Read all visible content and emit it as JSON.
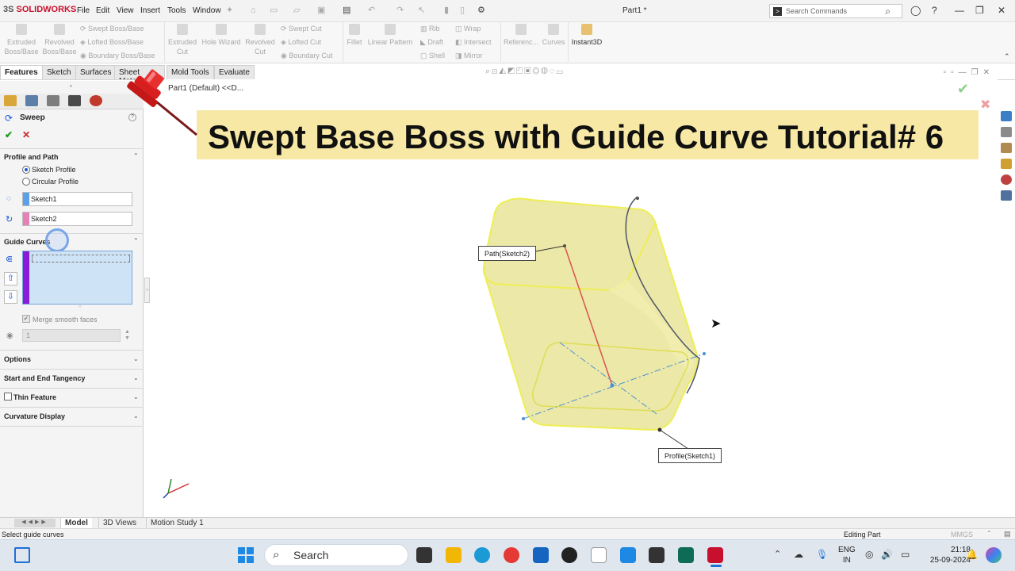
{
  "app": {
    "brand": "SOLIDWORKS",
    "brand_prefix": "3S",
    "document_title": "Part1 *",
    "menu": [
      "File",
      "Edit",
      "View",
      "Insert",
      "Tools",
      "Window"
    ],
    "command_search_placeholder": "Search Commands"
  },
  "ribbon": {
    "large": [
      {
        "label": "Extruded Boss/Base"
      },
      {
        "label": "Revolved Boss/Base"
      },
      {
        "label": "Extruded Cut"
      },
      {
        "label": "Hole Wizard"
      },
      {
        "label": "Revolved Cut"
      },
      {
        "label": "Fillet"
      },
      {
        "label": "Linear Pattern"
      },
      {
        "label": "Referenc..."
      },
      {
        "label": "Curves"
      },
      {
        "label": "Instant3D"
      }
    ],
    "small": [
      {
        "label": "Swept Boss/Base"
      },
      {
        "label": "Lofted Boss/Base"
      },
      {
        "label": "Boundary Boss/Base"
      },
      {
        "label": "Swept Cut"
      },
      {
        "label": "Lofted Cut"
      },
      {
        "label": "Boundary Cut"
      },
      {
        "label": "Rib"
      },
      {
        "label": "Draft"
      },
      {
        "label": "Shell"
      },
      {
        "label": "Wrap"
      },
      {
        "label": "Intersect"
      },
      {
        "label": "Mirror"
      }
    ]
  },
  "tabs": [
    "Features",
    "Sketch",
    "Surfaces",
    "Sheet Metal",
    "Mold Tools",
    "Evaluate"
  ],
  "tree_breadcrumb": "Part1 (Default) <<D...",
  "property_manager": {
    "title": "Sweep",
    "profile_and_path": {
      "heading": "Profile and Path",
      "option_sketch": "Sketch Profile",
      "option_circular": "Circular Profile",
      "profile_value": "Sketch1",
      "path_value": "Sketch2"
    },
    "guide_curves": {
      "heading": "Guide Curves",
      "merge_smooth": "Merge smooth faces",
      "count_value": "1"
    },
    "sections": [
      "Options",
      "Start and End Tangency",
      "Thin Feature",
      "Curvature Display"
    ]
  },
  "viewport": {
    "banner": "Swept Base Boss with Guide Curve Tutorial# 6",
    "callout_path": "Path(Sketch2)",
    "callout_profile": "Profile(Sketch1)"
  },
  "bottom_tabs": [
    "Model",
    "3D Views",
    "Motion Study 1"
  ],
  "status": {
    "left": "Select guide curves",
    "mode": "Editing Part",
    "units": "MMGS"
  },
  "taskbar": {
    "search": "Search",
    "lang_top": "ENG",
    "lang_bottom": "IN",
    "time": "21:18",
    "date": "25-09-2024"
  },
  "colors": {
    "banner_bg": "#f7e9a5",
    "part_fill": "#e6e08a",
    "part_edge": "#eeee55",
    "path_line": "#d9534f",
    "guide_curve": "#4a5568",
    "guide_list_bar": "#8a1bd8",
    "pin": "#e02020"
  },
  "icons": {
    "ok": "check-icon",
    "cancel": "close-icon",
    "pin": "pushpin-icon",
    "cursor": "mouse-cursor-icon"
  }
}
